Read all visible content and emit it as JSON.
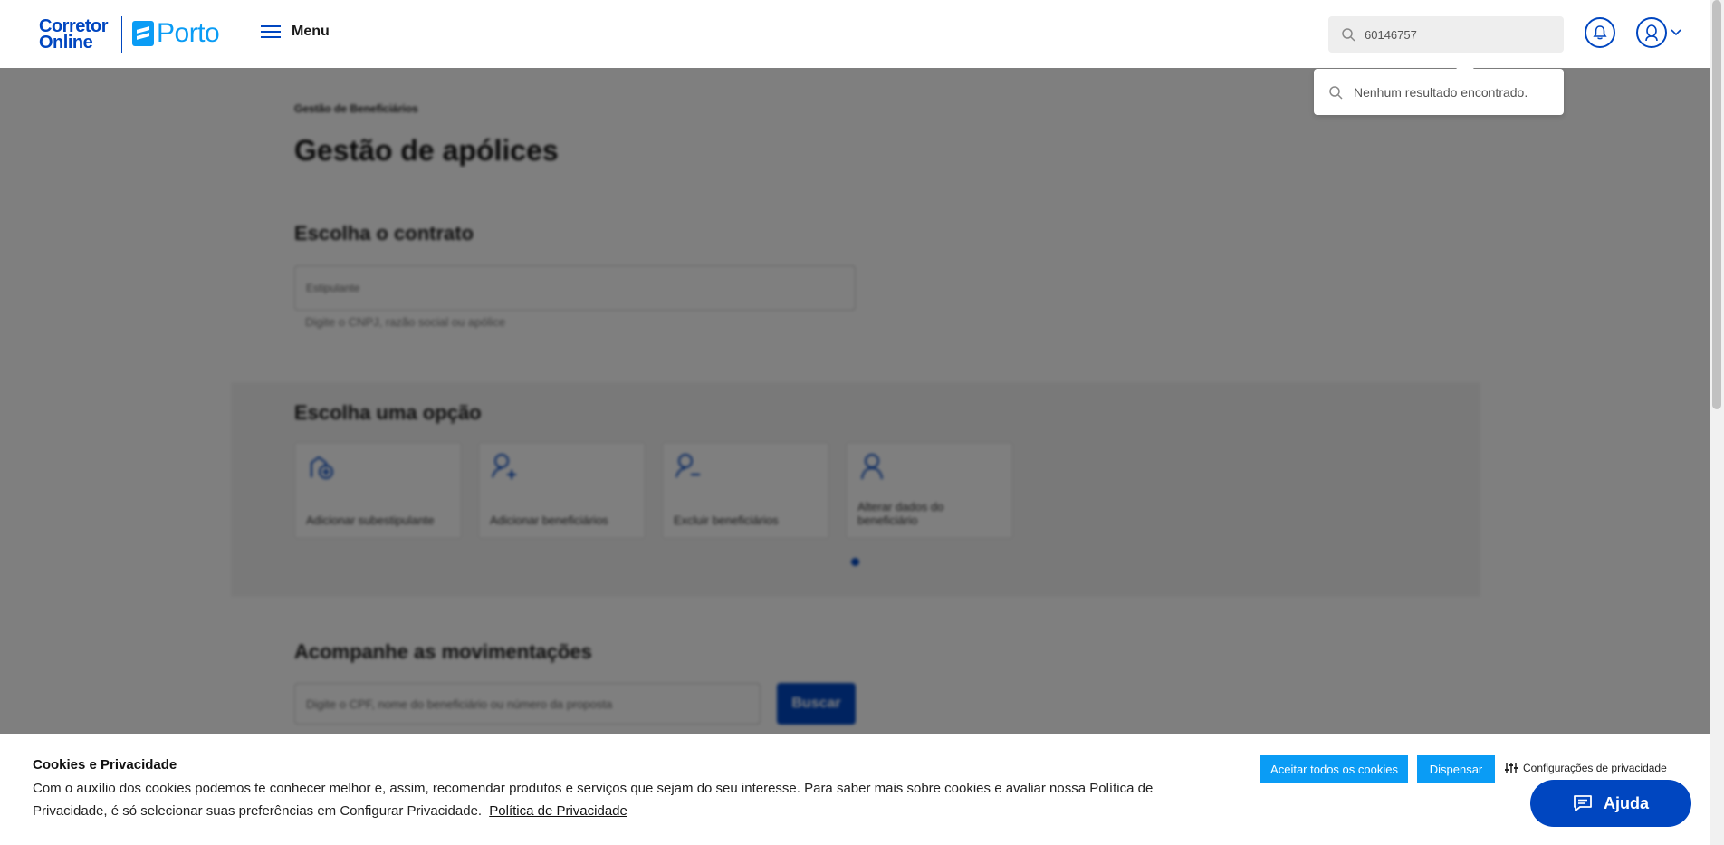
{
  "header": {
    "logo_corretor_line1": "Corretor",
    "logo_corretor_line2": "Online",
    "logo_porto": "Porto",
    "menu_label": "Menu",
    "search_value": "60146757",
    "search_dropdown_text": "Nenhum resultado encontrado."
  },
  "main": {
    "breadcrumb": "Gestão de Beneficiários",
    "page_title": "Gestão de apólices",
    "contract_section_title": "Escolha o contrato",
    "contract_input_placeholder": "Estipulante",
    "contract_help": "Digite o CNPJ, razão social ou apólice",
    "options_section_title": "Escolha uma opção",
    "options": [
      {
        "label": "Adicionar subestipulante",
        "icon": "building-add-icon"
      },
      {
        "label": "Adicionar beneficiários",
        "icon": "user-add-icon"
      },
      {
        "label": "Excluir beneficiários",
        "icon": "user-remove-icon"
      },
      {
        "label": "Alterar dados do beneficiário",
        "icon": "user-edit-icon"
      }
    ],
    "movements_section_title": "Acompanhe as movimentações",
    "movements_input_placeholder": "Digite o CPF, nome do beneficiário ou número da proposta",
    "movements_button": "Buscar"
  },
  "cookie": {
    "title": "Cookies e Privacidade",
    "text": "Com o auxílio dos cookies podemos te conhecer melhor e, assim, recomendar produtos e serviços que sejam do seu interesse. Para saber mais sobre cookies e avaliar nossa Política de Privacidade, é só selecionar suas preferências em Configurar Privacidade.",
    "link": "Política de Privacidade",
    "accept_button": "Aceitar todos os cookies",
    "dismiss_button": "Dispensar",
    "config_button": "Configurações de privacidade"
  },
  "help_button": "Ajuda",
  "colors": {
    "brand_dark": "#0046c0",
    "brand_light": "#0a9cf5"
  }
}
